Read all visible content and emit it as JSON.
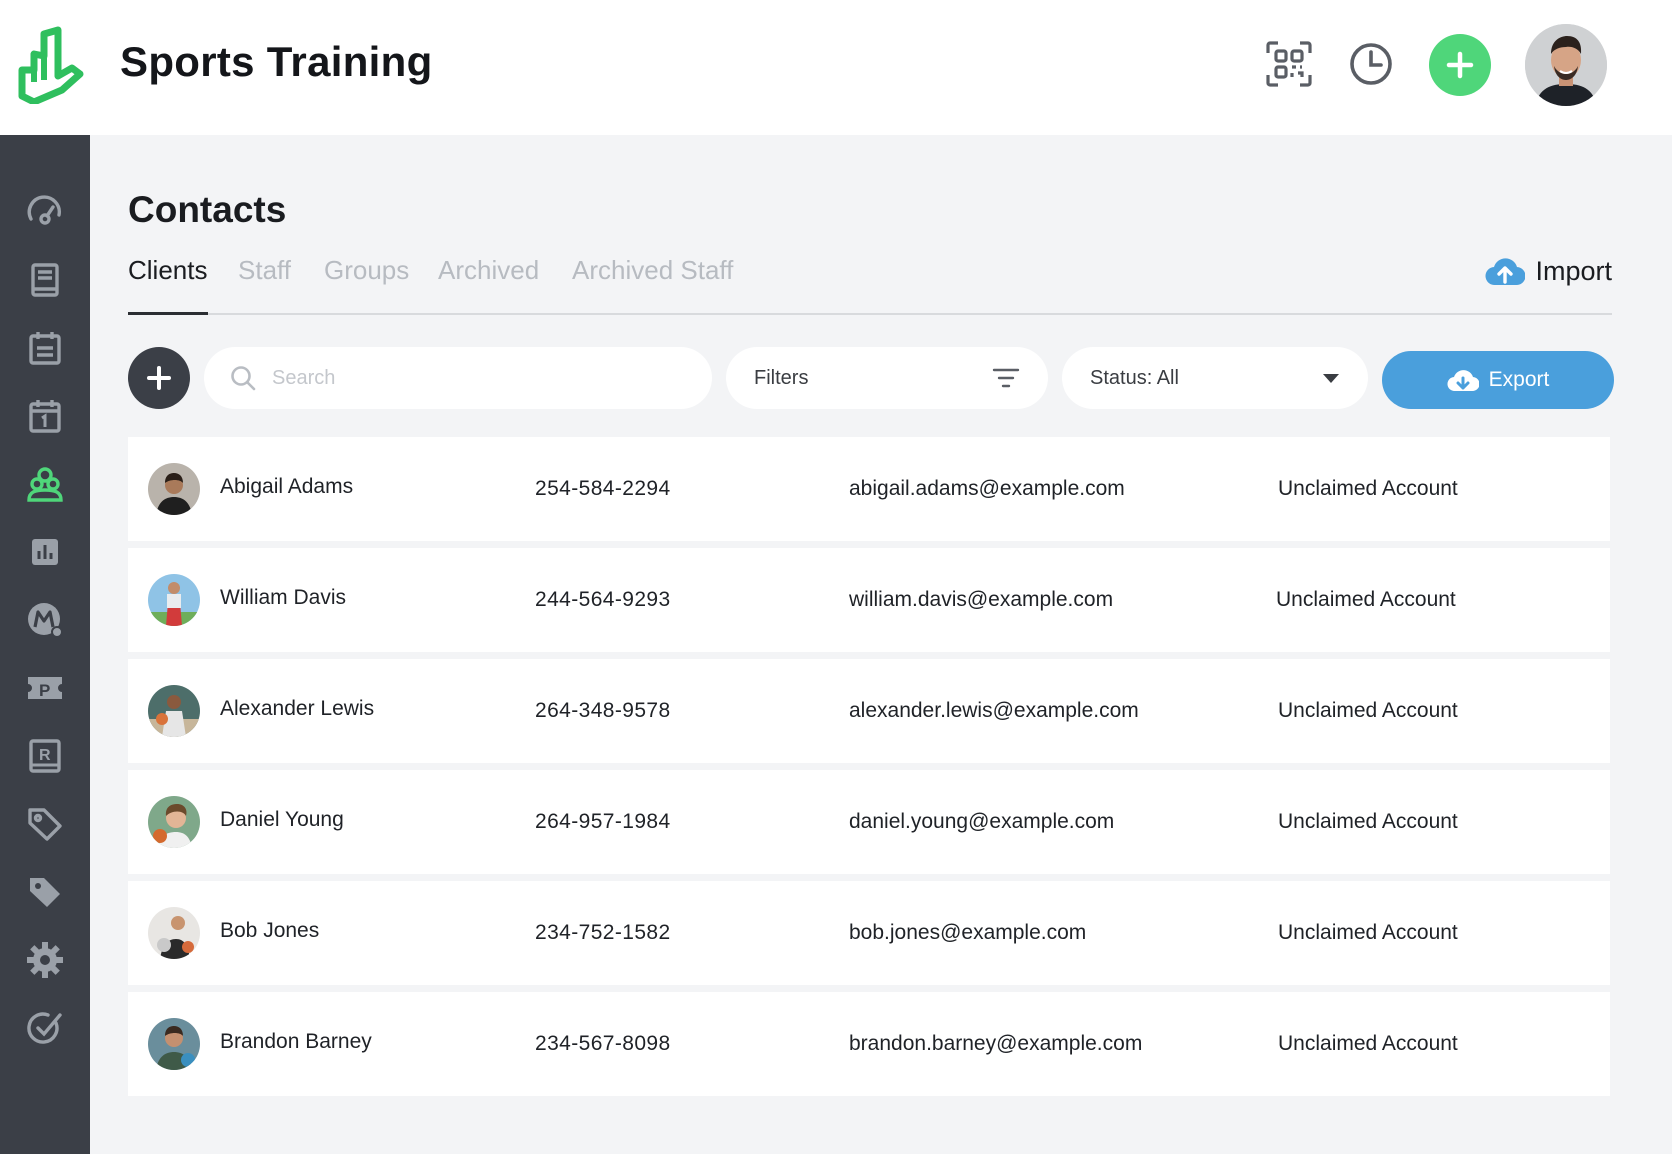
{
  "header": {
    "app_title": "Sports Training",
    "accent_color": "#4fd67a",
    "icons": [
      "logo-icon",
      "qr-code-icon",
      "history-clock-icon",
      "plus-icon",
      "user-avatar"
    ]
  },
  "sidebar": {
    "items": [
      {
        "icon": "dashboard-icon",
        "active": false
      },
      {
        "icon": "book-icon",
        "active": false
      },
      {
        "icon": "clipboard-icon",
        "active": false
      },
      {
        "icon": "calendar-icon",
        "active": false
      },
      {
        "icon": "contacts-icon",
        "active": true
      },
      {
        "icon": "reports-chart-icon",
        "active": false
      },
      {
        "icon": "marketing-icon",
        "active": false
      },
      {
        "icon": "pass-ticket-icon",
        "active": false
      },
      {
        "icon": "registration-icon",
        "active": false
      },
      {
        "icon": "tag-icon",
        "active": false
      },
      {
        "icon": "discount-tag-icon",
        "active": false
      },
      {
        "icon": "settings-gear-icon",
        "active": false
      },
      {
        "icon": "goals-target-icon",
        "active": false
      }
    ]
  },
  "main": {
    "page_title": "Contacts",
    "tabs": [
      {
        "label": "Clients",
        "active": true
      },
      {
        "label": "Staff",
        "active": false
      },
      {
        "label": "Groups",
        "active": false
      },
      {
        "label": "Archived",
        "active": false
      },
      {
        "label": "Archived Staff",
        "active": false
      }
    ],
    "import_label": "Import",
    "search_placeholder": "Search",
    "filters_label": "Filters",
    "status_label": "Status: All",
    "export_label": "Export",
    "export_color": "#4a9fdc"
  },
  "contacts": [
    {
      "name": "Abigail Adams",
      "phone": "254-584-2294",
      "email": "abigail.adams@example.com",
      "status": "Unclaimed Account"
    },
    {
      "name": "William Davis",
      "phone": "244-564-9293",
      "email": "william.davis@example.com",
      "status": "Unclaimed Account"
    },
    {
      "name": "Alexander Lewis",
      "phone": "264-348-9578",
      "email": "alexander.lewis@example.com",
      "status": "Unclaimed Account"
    },
    {
      "name": "Daniel Young",
      "phone": "264-957-1984",
      "email": "daniel.young@example.com",
      "status": "Unclaimed Account"
    },
    {
      "name": "Bob Jones",
      "phone": "234-752-1582",
      "email": "bob.jones@example.com",
      "status": "Unclaimed Account"
    },
    {
      "name": "Brandon Barney",
      "phone": "234-567-8098",
      "email": "brandon.barney@example.com",
      "status": "Unclaimed Account"
    }
  ]
}
